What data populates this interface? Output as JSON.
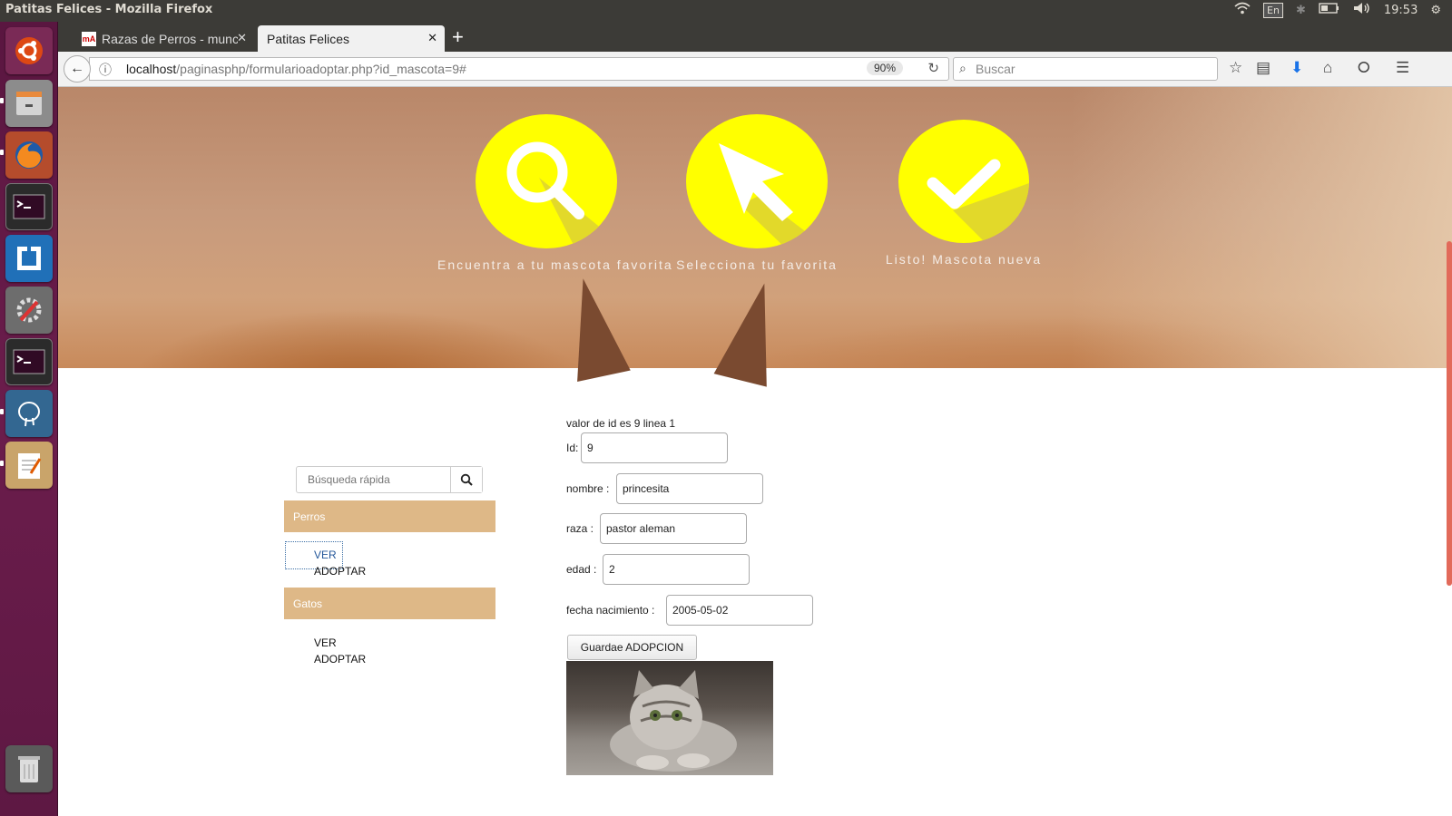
{
  "system": {
    "window_title": "Patitas Felices - Mozilla Firefox",
    "keyboard_layout": "En",
    "clock": "19:53"
  },
  "browser": {
    "tabs": [
      {
        "label": "Razas de Perros - munc",
        "active": false,
        "favicon_text": "mA"
      },
      {
        "label": "Patitas Felices",
        "active": true
      }
    ],
    "url_host": "localhost",
    "url_path": "/paginasphp/formularioadoptar.php?id_mascota=9#",
    "zoom": "90%",
    "search_placeholder": "Buscar"
  },
  "hero": {
    "steps": [
      {
        "label": "Encuentra a tu mascota favorita",
        "icon": "magnifier-icon"
      },
      {
        "label": "Selecciona tu favorita",
        "icon": "cursor-arrow-icon"
      },
      {
        "label": "Listo! Mascota nueva",
        "icon": "checkmark-icon"
      }
    ],
    "circle_color": "#ffff00"
  },
  "sidebar": {
    "search_placeholder": "Búsqueda rápida",
    "categories": [
      {
        "name": "Perros",
        "links": [
          "VER",
          "ADOPTAR"
        ]
      },
      {
        "name": "Gatos",
        "links": [
          "VER",
          "ADOPTAR"
        ]
      }
    ],
    "header_color": "#deb887"
  },
  "form": {
    "debug_text": "valor de id es 9 linea 1",
    "fields": {
      "id": {
        "label": "Id:",
        "value": "9"
      },
      "nombre": {
        "label": "nombre :",
        "value": "princesita"
      },
      "raza": {
        "label": "raza :",
        "value": "pastor aleman"
      },
      "edad": {
        "label": "edad :",
        "value": "2"
      },
      "fecha": {
        "label": "fecha nacimiento :",
        "value": "2005-05-02"
      }
    },
    "submit_label": "Guardae ADOPCION"
  }
}
